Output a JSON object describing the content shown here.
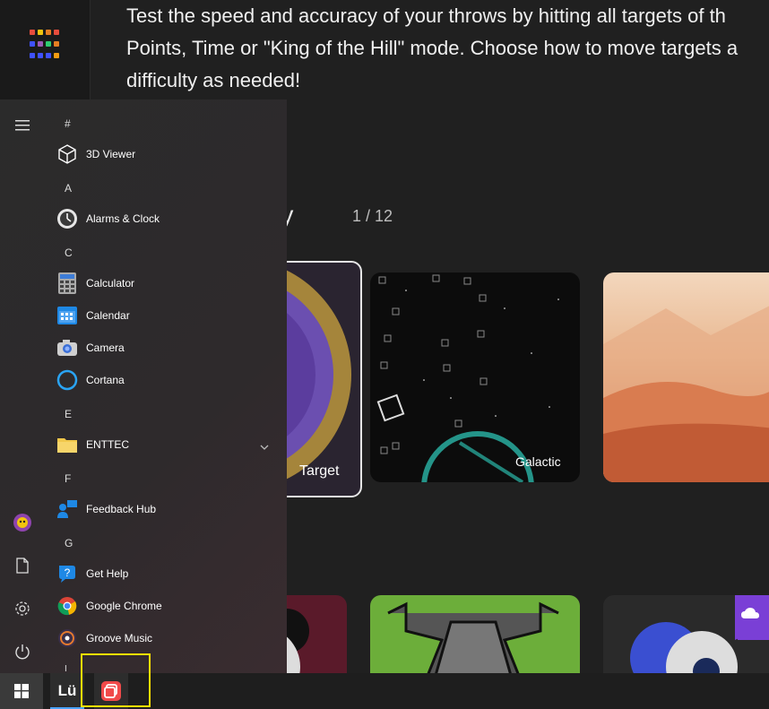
{
  "app": {
    "description_lines": [
      "Test the speed and accuracy of your throws by hitting all targets of th",
      "Points, Time or \"King of the Hill\" mode. Choose how to move targets a",
      "difficulty as needed!"
    ],
    "category_title_partial": "rity",
    "page_indicator": "1 / 12",
    "cards": [
      {
        "label": "Target"
      },
      {
        "label": "Galactic"
      },
      {
        "label": ""
      }
    ]
  },
  "start_menu": {
    "sections": [
      {
        "letter": "#",
        "items": [
          {
            "label": "3D Viewer",
            "icon": "cube-icon"
          }
        ]
      },
      {
        "letter": "A",
        "items": [
          {
            "label": "Alarms & Clock",
            "icon": "clock-icon"
          }
        ]
      },
      {
        "letter": "C",
        "items": [
          {
            "label": "Calculator",
            "icon": "calculator-icon"
          },
          {
            "label": "Calendar",
            "icon": "calendar-icon"
          },
          {
            "label": "Camera",
            "icon": "camera-icon"
          },
          {
            "label": "Cortana",
            "icon": "cortana-icon"
          }
        ]
      },
      {
        "letter": "E",
        "items": [
          {
            "label": "ENTTEC",
            "icon": "folder-icon"
          }
        ]
      },
      {
        "letter": "F",
        "items": [
          {
            "label": "Feedback Hub",
            "icon": "feedback-icon"
          }
        ]
      },
      {
        "letter": "G",
        "items": [
          {
            "label": "Get Help",
            "icon": "help-icon"
          },
          {
            "label": "Google Chrome",
            "icon": "chrome-icon"
          },
          {
            "label": "Groove Music",
            "icon": "music-icon"
          }
        ]
      }
    ],
    "next_letter": "I"
  },
  "taskbar": {
    "app_label": "Lü"
  },
  "colors": {
    "accent_highlight": "#ffe000",
    "background": "#202020"
  }
}
